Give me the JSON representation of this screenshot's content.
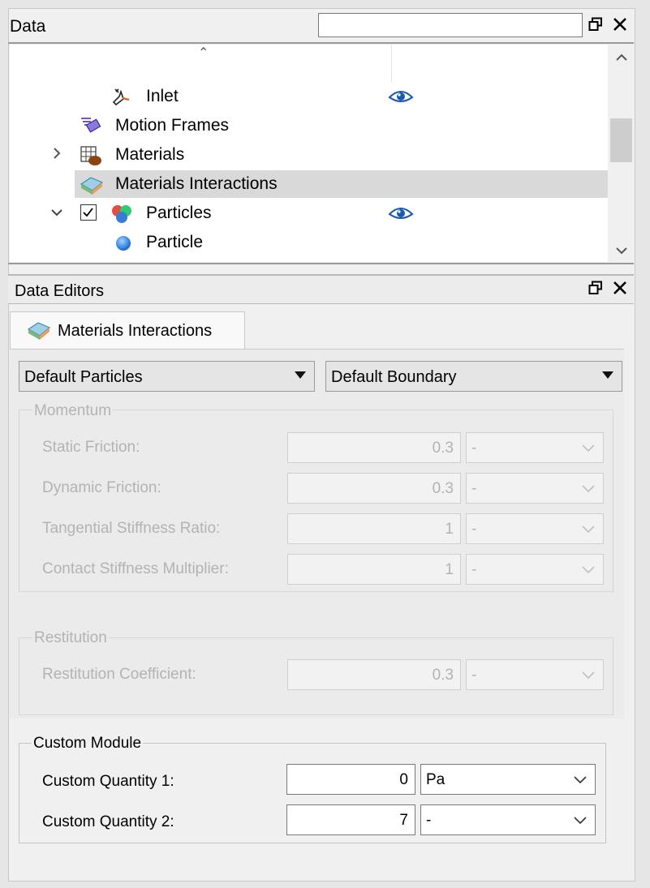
{
  "data_panel": {
    "title": "Data",
    "search_placeholder": "",
    "tree": [
      {
        "label": "Inlet",
        "icon": "inlet-icon",
        "visible_eye": true
      },
      {
        "label": "Motion Frames",
        "icon": "motion-frames-icon"
      },
      {
        "label": "Materials",
        "icon": "materials-icon",
        "expander": ">"
      },
      {
        "label": "Materials Interactions",
        "icon": "materials-interactions-icon",
        "selected": true
      },
      {
        "label": "Particles",
        "icon": "particles-icon",
        "expander": "⌄",
        "checked": true,
        "visible_eye": true
      },
      {
        "label": "Particle",
        "icon": "particle-icon"
      }
    ]
  },
  "editors_panel": {
    "title": "Data Editors",
    "tab_label": "Materials Interactions",
    "combo_left": "Default Particles",
    "combo_right": "Default Boundary",
    "momentum": {
      "title": "Momentum",
      "rows": [
        {
          "label": "Static Friction:",
          "value": "0.3",
          "unit": "-"
        },
        {
          "label": "Dynamic Friction:",
          "value": "0.3",
          "unit": "-"
        },
        {
          "label": "Tangential Stiffness Ratio:",
          "value": "1",
          "unit": "-"
        },
        {
          "label": "Contact Stiffness Multiplier:",
          "value": "1",
          "unit": "-"
        }
      ]
    },
    "restitution": {
      "title": "Restitution",
      "rows": [
        {
          "label": "Restitution Coefficient:",
          "value": "0.3",
          "unit": "-"
        }
      ]
    },
    "custom_module": {
      "title": "Custom Module",
      "rows": [
        {
          "label": "Custom Quantity 1:",
          "value": "0",
          "unit": "Pa"
        },
        {
          "label": "Custom Quantity 2:",
          "value": "7",
          "unit": "-"
        }
      ]
    }
  }
}
